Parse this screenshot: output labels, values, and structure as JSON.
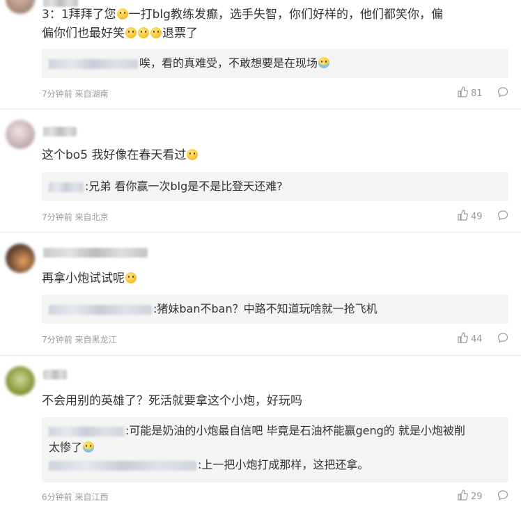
{
  "comments": [
    {
      "content": "3：1拜拜了您",
      "content_tail": "一打blg教练发癫，选手失智，你们好样的，他们都笑你，偏",
      "content_line2": "偏你们也最好笑",
      "content_line2_tail": "退票了",
      "replies": [
        {
          "text": "唉，看的真难受，不敢想要是在现场"
        }
      ],
      "meta": "7分钟前 来自湖南",
      "likes": "81"
    },
    {
      "content": "这个bo5 我好像在春天看过",
      "replies": [
        {
          "text": ":兄弟 看你赢一次blg是不是比登天还难?"
        }
      ],
      "meta": "7分钟前 来自北京",
      "likes": "49"
    },
    {
      "content": "再拿小炮试试呢",
      "replies": [
        {
          "text": ":猪妹ban不ban？中路不知道玩啥就一抢飞机"
        }
      ],
      "meta": "7分钟前 来自黑龙江",
      "likes": "44"
    },
    {
      "content": "不会用别的英雄了？死活就要拿这个小炮，好玩吗",
      "replies": [
        {
          "text": ":可能是奶油的小炮最自信吧 毕竟是石油杯能赢geng的 就是小炮被削",
          "text_line2": "太惨了"
        },
        {
          "text": ":上一把小炮打成那样，这把还拿。"
        }
      ],
      "meta": "6分钟前 来自江西",
      "likes": "29"
    }
  ],
  "icons": {
    "like": "thumbs-up-icon",
    "comment": "comment-bubble-icon",
    "emoji": "smiley-emoji-icon"
  },
  "colors": {
    "meta": "#999999",
    "reply_bg": "#f4f4f4",
    "divider": "#ececec"
  }
}
